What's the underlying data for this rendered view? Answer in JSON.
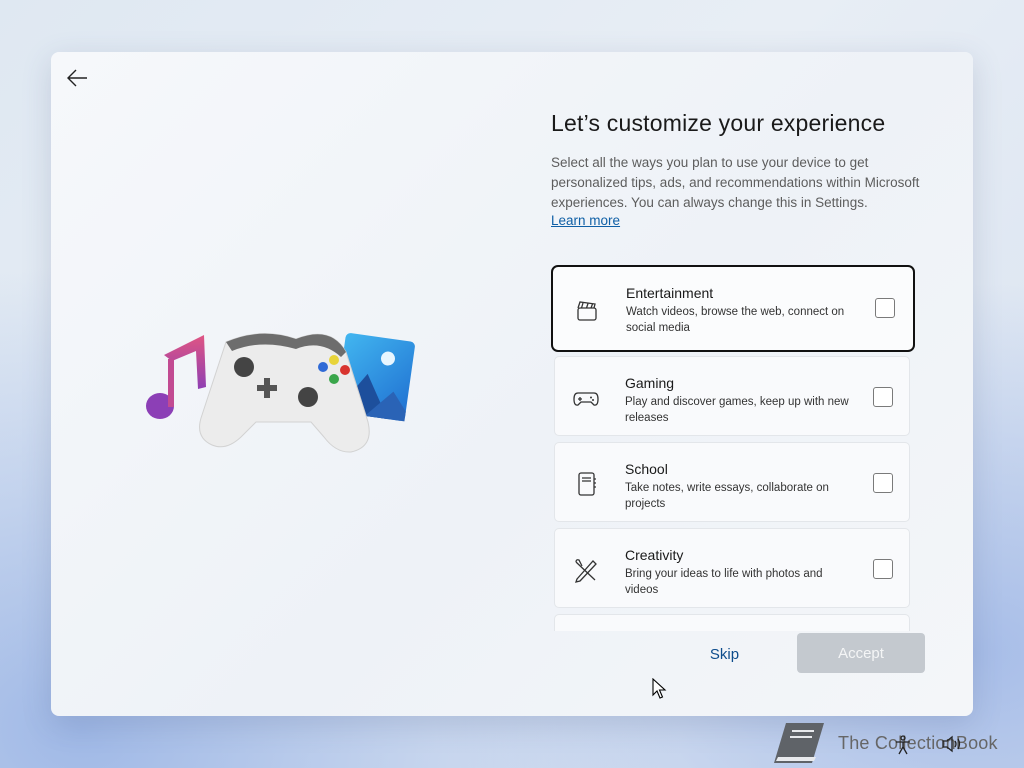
{
  "title": "Let’s customize your experience",
  "description": "Select all the ways you plan to use your device to get personalized tips, ads, and recommendations within Microsoft experiences. You can always change this in Settings.",
  "learn_more": "Learn more",
  "options": [
    {
      "icon": "clapperboard-icon",
      "name": "Entertainment",
      "sub": "Watch videos, browse the web, connect on social media",
      "checked": false
    },
    {
      "icon": "gamepad-icon",
      "name": "Gaming",
      "sub": "Play and discover games, keep up with new releases",
      "checked": false
    },
    {
      "icon": "notebook-icon",
      "name": "School",
      "sub": "Take notes, write essays, collaborate on projects",
      "checked": false
    },
    {
      "icon": "pen-brush-icon",
      "name": "Creativity",
      "sub": "Bring your ideas to life with photos and videos",
      "checked": false
    }
  ],
  "buttons": {
    "skip": "Skip",
    "accept": "Accept"
  },
  "watermark": "The CollectionBook",
  "colors": {
    "accent": "#0f5fa6",
    "disabled_button": "#c4c9cf",
    "focus_border": "#111111"
  }
}
